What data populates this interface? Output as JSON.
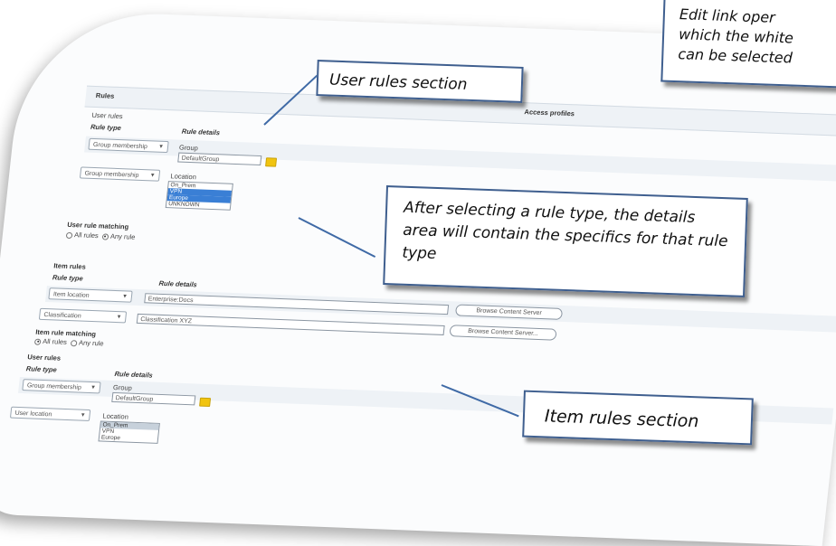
{
  "header": {
    "rules_label": "Rules",
    "access_profiles_label": "Access profiles"
  },
  "user_rules_top": {
    "section_label": "User rules",
    "col_rule_type": "Rule type",
    "col_rule_details": "Rule details",
    "row1": {
      "type": "Group membership",
      "detail_label": "Group",
      "value": "DefaultGroup"
    },
    "row2": {
      "type": "Group membership",
      "detail_label": "Location",
      "options": [
        "On_Prem",
        "VPN",
        "Europe",
        "UNKNOWN"
      ],
      "selected": [
        "VPN",
        "Europe"
      ]
    },
    "matching_label": "User rule matching",
    "opt_all": "All rules",
    "opt_any": "Any rule",
    "selected_option": "Any rule"
  },
  "item_rules": {
    "section_label": "Item rules",
    "col_rule_type": "Rule type",
    "col_rule_details": "Rule details",
    "row1": {
      "type": "Item location",
      "value": "Enterprise:Docs",
      "button": "Browse Content Server"
    },
    "row2": {
      "type": "Classification",
      "value": "Classification XYZ",
      "button": "Browse Content Server..."
    },
    "matching_label": "Item rule matching",
    "opt_all": "All rules",
    "opt_any": "Any rule",
    "selected_option": "All rules"
  },
  "user_rules_bottom": {
    "section_label": "User rules",
    "col_rule_type": "Rule type",
    "col_rule_details": "Rule details",
    "row1": {
      "type": "Group membership",
      "detail_label": "Group",
      "value": "DefaultGroup"
    },
    "row2": {
      "type": "User location",
      "detail_label": "Location",
      "options": [
        "On_Prem",
        "VPN",
        "Europe"
      ]
    }
  },
  "callouts": {
    "user_rules": "User rules section",
    "details": "After selecting a rule type, the details area will contain the specifics for that rule type",
    "item_rules": "Item rules section",
    "edit_link_line1": "Edit link oper",
    "edit_link_line2": "which the white",
    "edit_link_line3": "can be selected"
  }
}
